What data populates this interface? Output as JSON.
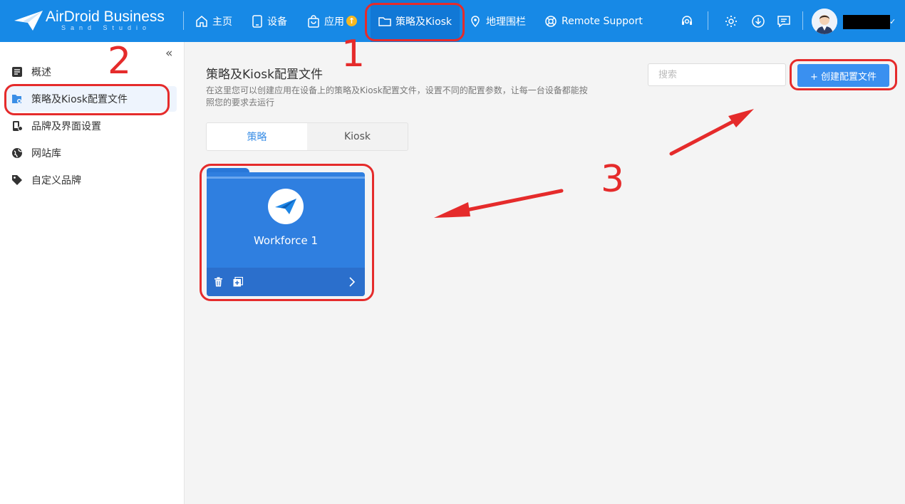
{
  "app": {
    "logo_name": "AirDroid Business",
    "logo_sub": "Sand Studio"
  },
  "nav": {
    "home": "主页",
    "devices": "设备",
    "apps": "应用",
    "apps_badge": "↑",
    "policy": "策略及Kiosk",
    "geofence": "地理围栏",
    "remote": "Remote Support"
  },
  "sidebar": {
    "collapse": "«",
    "items": [
      {
        "label": "概述",
        "icon": "overview-icon"
      },
      {
        "label": "策略及Kiosk配置文件",
        "icon": "policy-file-icon"
      },
      {
        "label": "品牌及界面设置",
        "icon": "brand-ui-icon"
      },
      {
        "label": "网站库",
        "icon": "globe-icon"
      },
      {
        "label": "自定义品牌",
        "icon": "tag-icon"
      }
    ]
  },
  "main": {
    "title": "策略及Kiosk配置文件",
    "description": "在这里您可以创建应用在设备上的策略及Kiosk配置文件，设置不同的配置参数，让每一台设备都能按照您的要求去运行",
    "search_placeholder": "搜索",
    "create_button": "+ 创建配置文件",
    "tabs": [
      {
        "label": "策略",
        "active": true
      },
      {
        "label": "Kiosk",
        "active": false
      }
    ],
    "profiles": [
      {
        "name": "Workforce 1"
      }
    ]
  },
  "annotations": {
    "n1": "1",
    "n2": "2",
    "n3": "3"
  },
  "colors": {
    "topbar": "#1789e6",
    "accent": "#3a90f0",
    "annotation": "#e52b2b",
    "folder": "#2f7fe0"
  }
}
